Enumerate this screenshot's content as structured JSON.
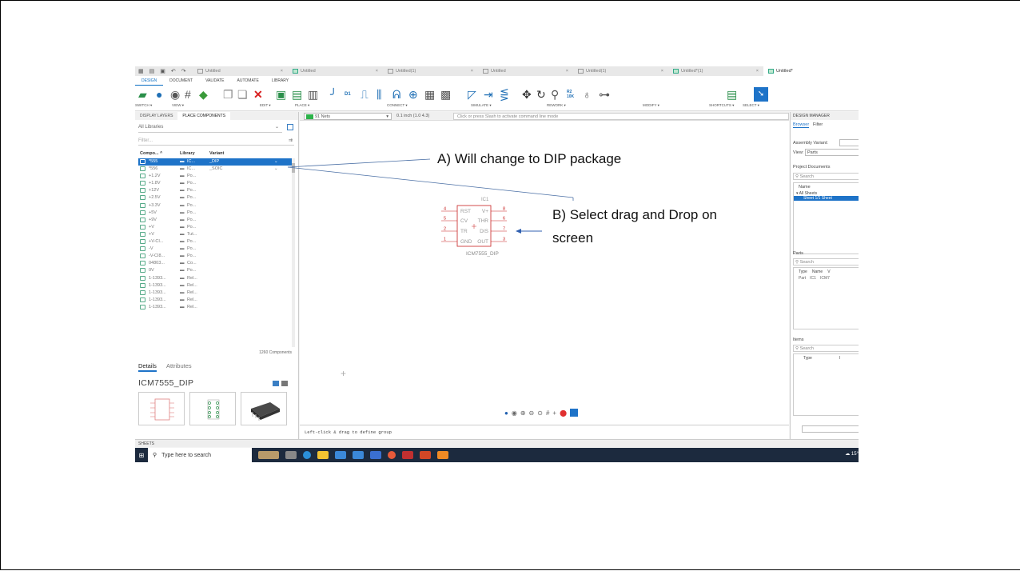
{
  "app": {
    "quick_icons": [
      "▦",
      "▤",
      "▣",
      "↶",
      "↷"
    ],
    "doc_tabs": [
      {
        "label": "Untitled",
        "icon": "schematic",
        "active": false
      },
      {
        "label": "Untitled",
        "icon": "board",
        "active": false
      },
      {
        "label": "Untitled(1)",
        "icon": "schematic",
        "active": false
      },
      {
        "label": "Untitled",
        "icon": "doc",
        "active": false
      },
      {
        "label": "Untitled(1)",
        "icon": "doc",
        "active": false
      },
      {
        "label": "Untitled*(1)",
        "icon": "board",
        "active": false
      },
      {
        "label": "Untitled*",
        "icon": "board",
        "active": true
      }
    ],
    "close_glyph": "×"
  },
  "ribbon": {
    "tabs": [
      "DESIGN",
      "DOCUMENT",
      "VALIDATE",
      "AUTOMATE",
      "LIBRARY"
    ],
    "active_tab": "DESIGN",
    "groups": [
      "SWITCH ▾",
      "VIEW ▾",
      "EDIT ▾",
      "PLACE ▾",
      "CONNECT ▾",
      "SIMULATE ▾",
      "REWORK ▾",
      "MODIFY ▾",
      "SHORTCUTS ▾",
      "SELECT ▾"
    ],
    "icon_texts": {
      "d1": "D1",
      "r2": "R2",
      "r2_value": "10K"
    }
  },
  "left_panel": {
    "tabs": [
      "DISPLAY LAYERS",
      "PLACE COMPONENTS"
    ],
    "library_select": "All Libraries",
    "filter_placeholder": "Filter...",
    "columns": [
      "Compo... ^",
      "Library",
      "Variant"
    ],
    "rows": [
      {
        "name": "*555",
        "library": "IC...",
        "variant": "_DIP",
        "selected": true
      },
      {
        "name": "*556",
        "library": "IC...",
        "variant": "_SOIC",
        "selected": false
      },
      {
        "name": "+1.2V",
        "library": "Po...",
        "variant": "",
        "selected": false
      },
      {
        "name": "+1.8V",
        "library": "Po...",
        "variant": "",
        "selected": false
      },
      {
        "name": "+12V",
        "library": "Po...",
        "variant": "",
        "selected": false
      },
      {
        "name": "+2.5V",
        "library": "Po...",
        "variant": "",
        "selected": false
      },
      {
        "name": "+3.3V",
        "library": "Po...",
        "variant": "",
        "selected": false
      },
      {
        "name": "+5V",
        "library": "Po...",
        "variant": "",
        "selected": false
      },
      {
        "name": "+9V",
        "library": "Po...",
        "variant": "",
        "selected": false
      },
      {
        "name": "+V",
        "library": "Po...",
        "variant": "",
        "selected": false
      },
      {
        "name": "+V",
        "library": "Tut...",
        "variant": "",
        "selected": false
      },
      {
        "name": "+V-CI...",
        "library": "Po...",
        "variant": "",
        "selected": false
      },
      {
        "name": "-V",
        "library": "Po...",
        "variant": "",
        "selected": false
      },
      {
        "name": "-V-CI8...",
        "library": "Po...",
        "variant": "",
        "selected": false
      },
      {
        "name": "04803...",
        "library": "Co...",
        "variant": "",
        "selected": false
      },
      {
        "name": "0V",
        "library": "Po...",
        "variant": "",
        "selected": false
      },
      {
        "name": "1-1393...",
        "library": "Rel...",
        "variant": "",
        "selected": false
      },
      {
        "name": "1-1393...",
        "library": "Rel...",
        "variant": "",
        "selected": false
      },
      {
        "name": "1-1393...",
        "library": "Rel...",
        "variant": "",
        "selected": false
      },
      {
        "name": "1-1393...",
        "library": "Rel...",
        "variant": "",
        "selected": false
      },
      {
        "name": "1-1393...",
        "library": "Rel...",
        "variant": "",
        "selected": false
      }
    ],
    "component_count": "1260 Components",
    "detail_tabs": [
      "Details",
      "Attributes"
    ],
    "part_name": "ICM7555_DIP",
    "symbol_labels": {
      "top": ">NAME",
      "bottom": ">VALUE"
    }
  },
  "canvas": {
    "net_select": "91 Nets",
    "grid": "0.1 inch (1.0 4.3)",
    "command_placeholder": "Click or press Slash to activate command line mode",
    "status": "Left-click & drag to define group",
    "symbol": {
      "ref": "IC1",
      "value": "ICM7555_DIP",
      "left_pins": [
        {
          "num": "4",
          "name": "RST"
        },
        {
          "num": "5",
          "name": "CV"
        },
        {
          "num": "2",
          "name": "TR"
        },
        {
          "num": "1",
          "name": "GND"
        }
      ],
      "right_pins": [
        {
          "num": "8",
          "name": "V+"
        },
        {
          "num": "6",
          "name": "THR"
        },
        {
          "num": "7",
          "name": "DIS"
        },
        {
          "num": "3",
          "name": "OUT"
        }
      ]
    },
    "crosshair": "+"
  },
  "right_panel": {
    "header": "DESIGN MANAGER",
    "tabs": [
      "Browser",
      "Filter"
    ],
    "assembly_label": "Assembly Variant:",
    "view_label": "View:",
    "view_value": "Parts",
    "project_docs": "Project Documents",
    "search": "Search",
    "tree_header": "Name",
    "tree_items": [
      "All Sheets",
      "Sheet 1/1 Sheet"
    ],
    "parts_label": "Parts",
    "parts_columns": [
      "Type",
      "Name",
      "V"
    ],
    "parts_row": [
      "Part",
      "IC1",
      "ICM7"
    ],
    "items_label": "Items",
    "items_columns": [
      "Type",
      "I"
    ]
  },
  "footer": {
    "sheets": "SHEETS",
    "taskbar_search": "Type here to search",
    "weather": "15°"
  },
  "annotations": {
    "a": "A) Will change to DIP package",
    "b_line1": "B) Select drag and Drop  on",
    "b_line2": "screen"
  }
}
